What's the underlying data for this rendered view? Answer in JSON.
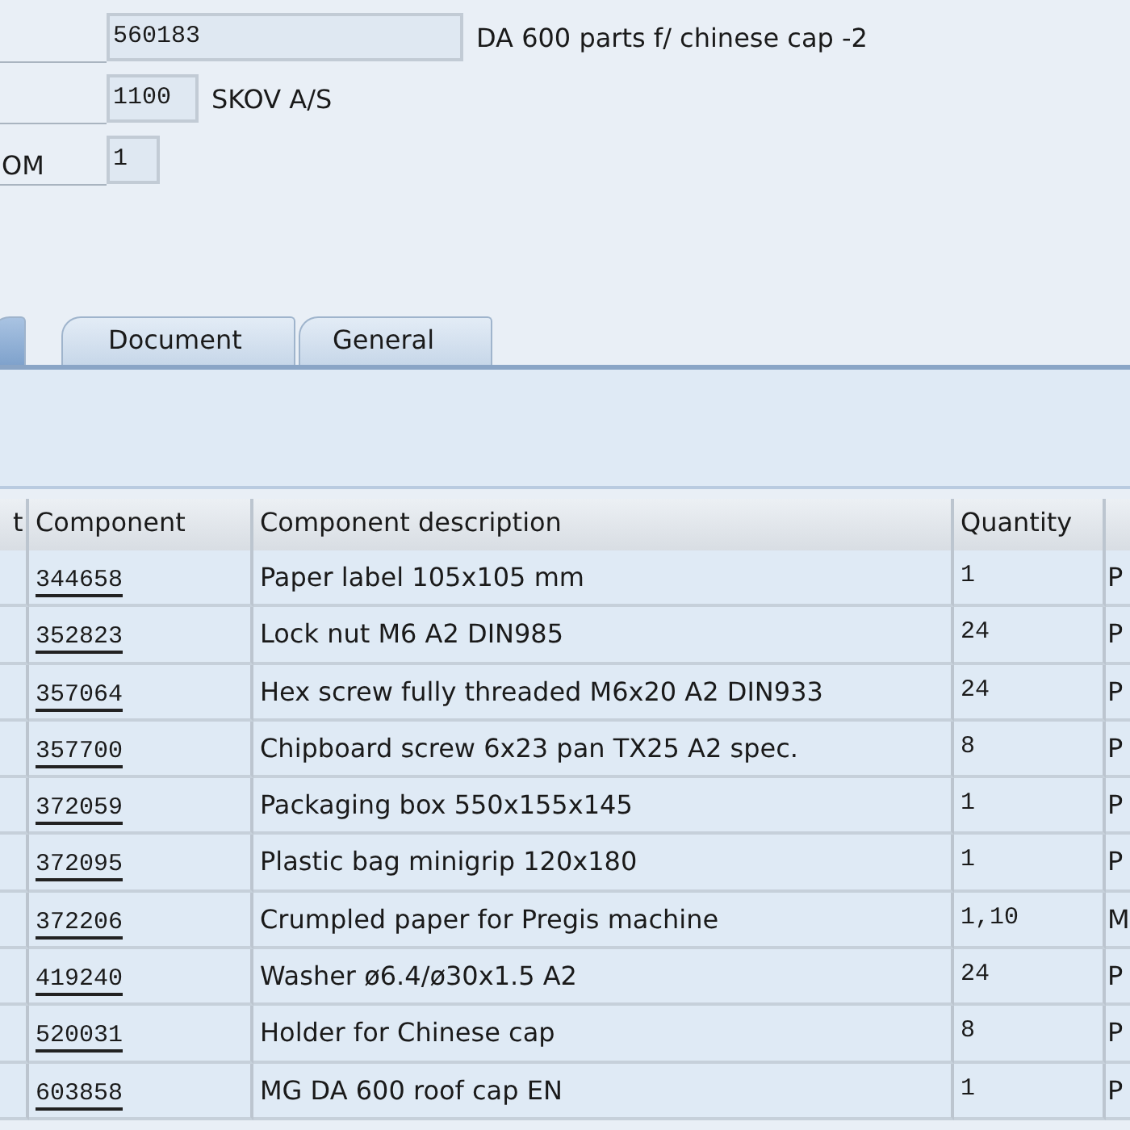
{
  "header_fields": [
    {
      "value": "560183",
      "description": "DA 600 parts f/ chinese cap -2"
    },
    {
      "value": "1100",
      "description": "SKOV A/S"
    },
    {
      "label": "OM",
      "value": "1"
    }
  ],
  "tabs": [
    {
      "selected": true
    },
    {
      "label": "Document",
      "selected": false
    },
    {
      "label": "General",
      "selected": false
    }
  ],
  "table": {
    "columns": [
      "t",
      "Component",
      "Component description",
      "Quantity",
      ""
    ],
    "rows": [
      {
        "component": "344658",
        "description": "Paper label 105x105 mm",
        "quantity": "1",
        "column_5": "P"
      },
      {
        "component": "352823",
        "description": "Lock nut M6 A2 DIN985",
        "quantity": "24",
        "column_5": "P"
      },
      {
        "component": "357064",
        "description": "Hex screw fully threaded M6x20 A2 DIN933",
        "quantity": "24",
        "column_5": "P"
      },
      {
        "component": "357700",
        "description": "Chipboard screw 6x23 pan TX25 A2 spec.",
        "quantity": "8",
        "column_5": "P"
      },
      {
        "component": "372059",
        "description": "Packaging box 550x155x145",
        "quantity": "1",
        "column_5": "P"
      },
      {
        "component": "372095",
        "description": "Plastic bag minigrip 120x180",
        "quantity": "1",
        "column_5": "P"
      },
      {
        "component": "372206",
        "description": "Crumpled paper for Pregis machine",
        "quantity": "1,10",
        "column_5": "M"
      },
      {
        "component": "419240",
        "description": "Washer ø6.4/ø30x1.5 A2",
        "quantity": "24",
        "column_5": "P"
      },
      {
        "component": "520031",
        "description": "Holder for Chinese cap",
        "quantity": "8",
        "column_5": "P"
      },
      {
        "component": "603858",
        "description": "MG DA 600 roof cap EN",
        "quantity": "1",
        "column_5": "P"
      }
    ]
  }
}
